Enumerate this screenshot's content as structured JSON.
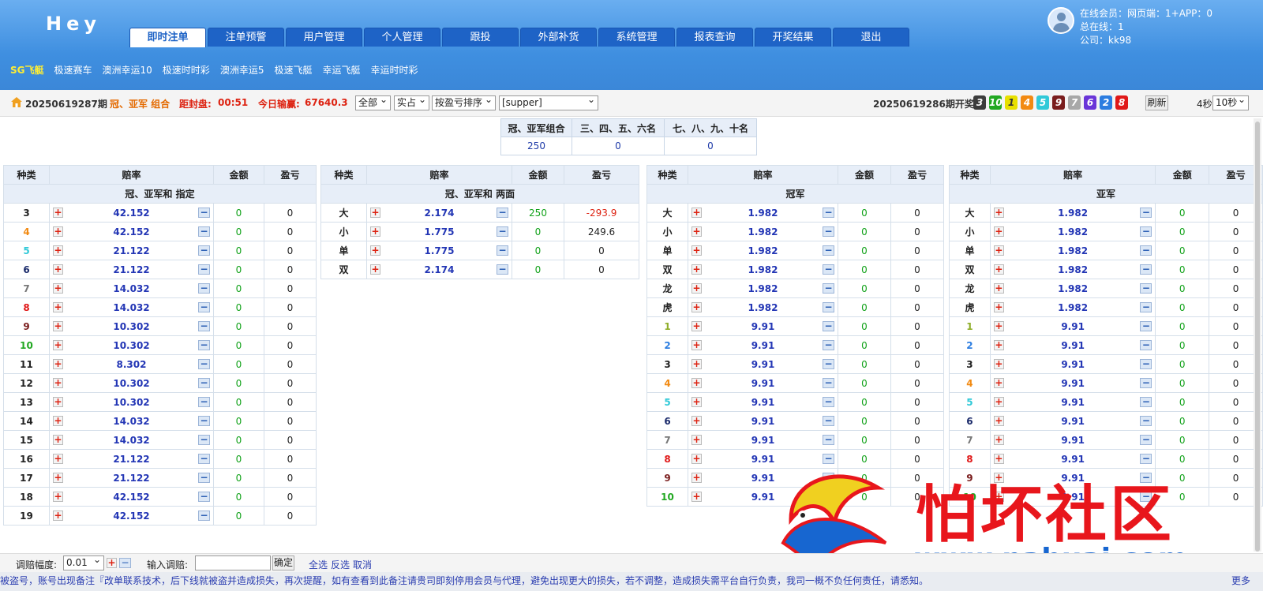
{
  "header": {
    "logo": "Hey",
    "nav": [
      "即时注单",
      "注单预警",
      "用户管理",
      "个人管理",
      "跟投",
      "外部补货",
      "系统管理",
      "报表查询",
      "开奖结果",
      "退出"
    ],
    "user_lines": [
      "在线会员：网页端：1+APP：0",
      "总在线：1",
      "公司：kk98"
    ],
    "subnav": [
      "SG飞艇",
      "极速赛车",
      "澳洲幸运10",
      "极速时时彩",
      "澳洲幸运5",
      "极速飞艇",
      "幸运飞艇",
      "幸运时时彩"
    ]
  },
  "infobar": {
    "period": "20250619287期",
    "play": "冠、亚军 组合",
    "close_label": "距封盘:",
    "close_time": "00:51",
    "today_label": "今日输赢:",
    "today_value": "67640.3",
    "selects": [
      "全部",
      "实占",
      "按盈亏排序",
      "[supper]"
    ],
    "draw_label": "20250619286期开奖",
    "draw_balls": [
      {
        "n": "3",
        "color": "#3c3c3c"
      },
      {
        "n": "10",
        "color": "#22a822"
      },
      {
        "n": "1",
        "color": "#e8e000"
      },
      {
        "n": "4",
        "color": "#f28a12"
      },
      {
        "n": "5",
        "color": "#31c9d8"
      },
      {
        "n": "9",
        "color": "#7a1d1d"
      },
      {
        "n": "7",
        "color": "#a8a8a8"
      },
      {
        "n": "6",
        "color": "#6a35d8"
      },
      {
        "n": "2",
        "color": "#2c7de0"
      },
      {
        "n": "8",
        "color": "#e01818"
      }
    ],
    "refresh": "刷新",
    "timer": "4秒",
    "interval": "10秒"
  },
  "summary": {
    "headers": [
      "冠、亚军组合",
      "三、四、五、六名",
      "七、八、九、十名"
    ],
    "values": [
      "250",
      "0",
      "0"
    ]
  },
  "columns": [
    "种类",
    "赔率",
    "金额",
    "盈亏"
  ],
  "panels": [
    {
      "section": "冠、亚军和 指定",
      "rows": [
        [
          "3",
          "42.152",
          "0",
          "0"
        ],
        [
          "4",
          "42.152",
          "0",
          "0"
        ],
        [
          "5",
          "21.122",
          "0",
          "0"
        ],
        [
          "6",
          "21.122",
          "0",
          "0"
        ],
        [
          "7",
          "14.032",
          "0",
          "0"
        ],
        [
          "8",
          "14.032",
          "0",
          "0"
        ],
        [
          "9",
          "10.302",
          "0",
          "0"
        ],
        [
          "10",
          "10.302",
          "0",
          "0"
        ],
        [
          "11",
          "8.302",
          "0",
          "0"
        ],
        [
          "12",
          "10.302",
          "0",
          "0"
        ],
        [
          "13",
          "10.302",
          "0",
          "0"
        ],
        [
          "14",
          "14.032",
          "0",
          "0"
        ],
        [
          "15",
          "14.032",
          "0",
          "0"
        ],
        [
          "16",
          "21.122",
          "0",
          "0"
        ],
        [
          "17",
          "21.122",
          "0",
          "0"
        ],
        [
          "18",
          "42.152",
          "0",
          "0"
        ],
        [
          "19",
          "42.152",
          "0",
          "0"
        ]
      ]
    },
    {
      "section": "冠、亚军和 两面",
      "rows": [
        [
          "大",
          "2.174",
          "250",
          "-293.9"
        ],
        [
          "小",
          "1.775",
          "0",
          "249.6"
        ],
        [
          "单",
          "1.775",
          "0",
          "0"
        ],
        [
          "双",
          "2.174",
          "0",
          "0"
        ]
      ]
    },
    {
      "section": "冠军",
      "rows": [
        [
          "大",
          "1.982",
          "0",
          "0"
        ],
        [
          "小",
          "1.982",
          "0",
          "0"
        ],
        [
          "单",
          "1.982",
          "0",
          "0"
        ],
        [
          "双",
          "1.982",
          "0",
          "0"
        ],
        [
          "龙",
          "1.982",
          "0",
          "0"
        ],
        [
          "虎",
          "1.982",
          "0",
          "0"
        ],
        [
          "1",
          "9.91",
          "0",
          "0"
        ],
        [
          "2",
          "9.91",
          "0",
          "0"
        ],
        [
          "3",
          "9.91",
          "0",
          "0"
        ],
        [
          "4",
          "9.91",
          "0",
          "0"
        ],
        [
          "5",
          "9.91",
          "0",
          "0"
        ],
        [
          "6",
          "9.91",
          "0",
          "0"
        ],
        [
          "7",
          "9.91",
          "0",
          "0"
        ],
        [
          "8",
          "9.91",
          "0",
          "0"
        ],
        [
          "9",
          "9.91",
          "0",
          "0"
        ],
        [
          "10",
          "9.91",
          "0",
          "0"
        ]
      ]
    },
    {
      "section": "亚军",
      "rows": [
        [
          "大",
          "1.982",
          "0",
          "0"
        ],
        [
          "小",
          "1.982",
          "0",
          "0"
        ],
        [
          "单",
          "1.982",
          "0",
          "0"
        ],
        [
          "双",
          "1.982",
          "0",
          "0"
        ],
        [
          "龙",
          "1.982",
          "0",
          "0"
        ],
        [
          "虎",
          "1.982",
          "0",
          "0"
        ],
        [
          "1",
          "9.91",
          "0",
          "0"
        ],
        [
          "2",
          "9.91",
          "0",
          "0"
        ],
        [
          "3",
          "9.91",
          "0",
          "0"
        ],
        [
          "4",
          "9.91",
          "0",
          "0"
        ],
        [
          "5",
          "9.91",
          "0",
          "0"
        ],
        [
          "6",
          "9.91",
          "0",
          "0"
        ],
        [
          "7",
          "9.91",
          "0",
          "0"
        ],
        [
          "8",
          "9.91",
          "0",
          "0"
        ],
        [
          "9",
          "9.91",
          "0",
          "0"
        ],
        [
          "10",
          "9.91",
          "0",
          "0"
        ]
      ]
    }
  ],
  "number_colors": {
    "1": "#8fae2a",
    "2": "#2c7de0",
    "3": "#222222",
    "4": "#f28a12",
    "5": "#31c9d8",
    "6": "#1a2a6a",
    "7": "#777777",
    "8": "#e01818",
    "9": "#7a1d1d",
    "10": "#22a822"
  },
  "bottom": {
    "adjust_label": "调赔幅度:",
    "adjust_value": "0.01",
    "input_label": "输入调赔:",
    "confirm": "确定",
    "select_all": "全选",
    "invert": "反选",
    "cancel": "取消"
  },
  "marquee": {
    "text": "被盗号，账号出现备注『改单联系技术，后下线就被盗并造成损失，再次提醒，如有查看到此备注请贵司即刻停用会员与代理，避免出现更大的损失，若不调整，造成损失需平台自行负责，我司一概不负任何责任，请悉知。",
    "more": "更多"
  },
  "watermark": {
    "text": "怕坏社区",
    "url": "www.pahuai.com"
  }
}
